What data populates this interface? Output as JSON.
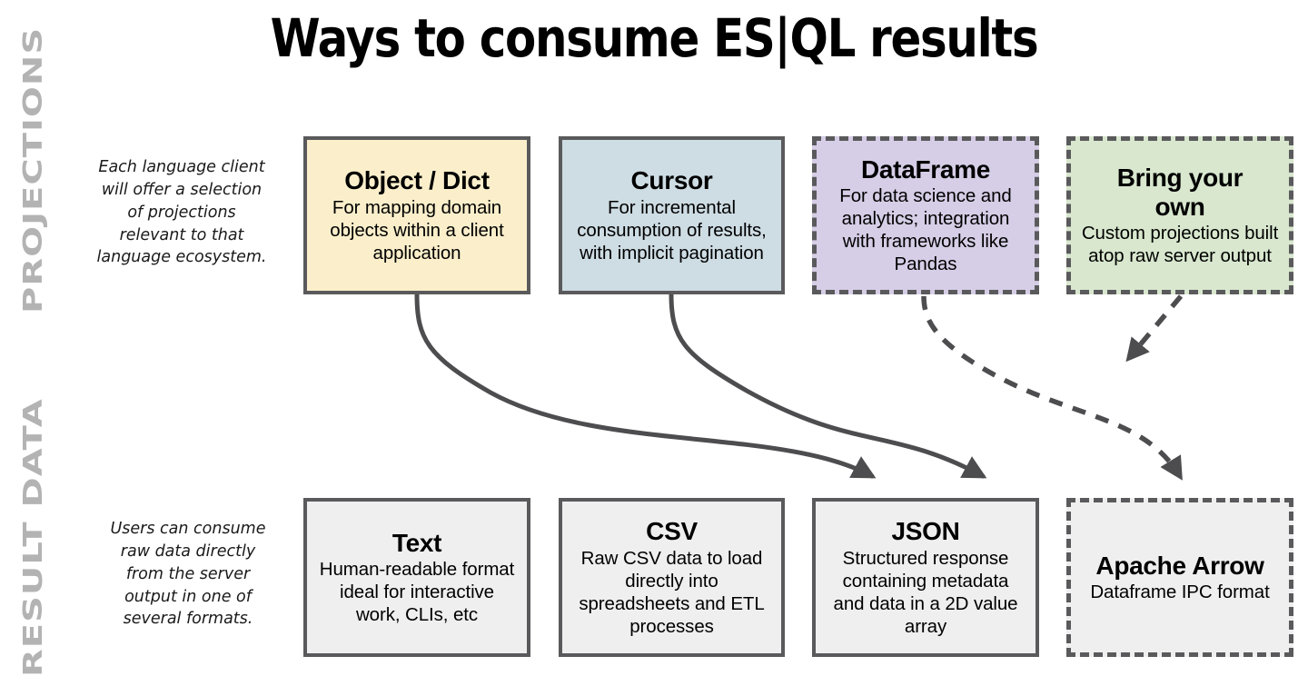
{
  "page": {
    "title": "Ways to consume ES|QL results",
    "background_color": "#ffffff"
  },
  "bands": [
    {
      "id": "projections",
      "label": "PROJECTIONS",
      "label_color": "#b3b3b3",
      "description": "Each language client will offer a selection of projections relevant to that language ecosystem."
    },
    {
      "id": "result-data",
      "label": "RESULT DATA",
      "label_color": "#b3b3b3",
      "description": "Users can consume raw data directly from the server output in one of several formats."
    }
  ],
  "projection_boxes": [
    {
      "id": "object-dict",
      "title": "Object / Dict",
      "description": "For mapping domain objects within a client application",
      "fill": "#fbefcb",
      "border_style": "solid",
      "border_color": "#5a5a5c"
    },
    {
      "id": "cursor",
      "title": "Cursor",
      "description": "For incremental consumption of results, with implicit pagination",
      "fill": "#cedce3",
      "border_style": "solid",
      "border_color": "#5a5a5c"
    },
    {
      "id": "dataframe",
      "title": "DataFrame",
      "description": "For data science and analytics; integration with frameworks like Pandas",
      "fill": "#d6cde6",
      "border_style": "dashed",
      "border_color": "#5a5a5c"
    },
    {
      "id": "bring-your-own",
      "title": "Bring your own",
      "description": "Custom projections built atop raw server output",
      "fill": "#d8e7ce",
      "border_style": "dashed",
      "border_color": "#5a5a5c"
    }
  ],
  "result_boxes": [
    {
      "id": "text",
      "title": "Text",
      "description": "Human-readable format ideal for interactive work, CLIs, etc",
      "fill": "#efefef",
      "border_style": "solid",
      "border_color": "#5a5a5c"
    },
    {
      "id": "csv",
      "title": "CSV",
      "description": "Raw CSV data to load directly into spreadsheets and ETL processes",
      "fill": "#efefef",
      "border_style": "solid",
      "border_color": "#5a5a5c"
    },
    {
      "id": "json",
      "title": "JSON",
      "description": "Structured response containing metadata and data in a 2D value array",
      "fill": "#efefef",
      "border_style": "solid",
      "border_color": "#5a5a5c"
    },
    {
      "id": "apache-arrow",
      "title": "Apache Arrow",
      "description": "Dataframe IPC format",
      "fill": "#efefef",
      "border_style": "dashed",
      "border_color": "#5a5a5c"
    }
  ],
  "connectors": [
    {
      "id": "object-dict-to-json",
      "from": "object-dict",
      "to": "json",
      "style": "solid",
      "color": "#4d4d4f"
    },
    {
      "id": "cursor-to-json",
      "from": "cursor",
      "to": "json",
      "style": "solid",
      "color": "#4d4d4f"
    },
    {
      "id": "dataframe-to-apache-arrow",
      "from": "dataframe",
      "to": "apache-arrow",
      "style": "dashed",
      "color": "#4d4d4f"
    },
    {
      "id": "bring-your-own-to-dataframe-path",
      "from": "bring-your-own",
      "to": "dataframe-to-apache-arrow",
      "style": "dashed",
      "color": "#4d4d4f"
    }
  ]
}
